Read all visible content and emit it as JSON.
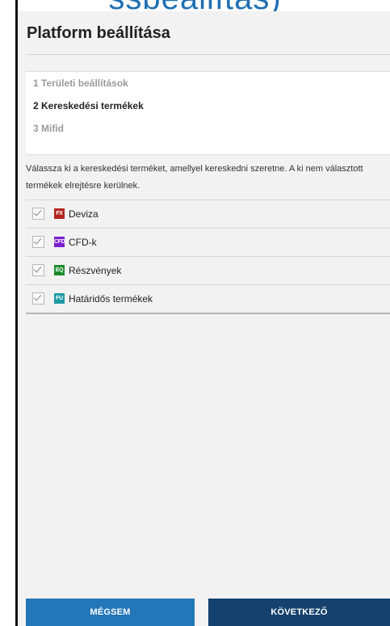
{
  "window": {
    "top_caption": "ssbeállítás)"
  },
  "header": {
    "title": "Platform beállítása"
  },
  "steps": [
    {
      "label": "1 Területi beállítások",
      "state": "inactive"
    },
    {
      "label": "2 Kereskedési termékek",
      "state": "active"
    },
    {
      "label": "3 Mifid",
      "state": "inactive"
    }
  ],
  "description": "Válassza ki a kereskedési terméket, amellyel kereskedni szeretne. A ki nem választott termékek elrejtésre kerülnek.",
  "products": [
    {
      "badge": "FX",
      "label": "Deviza",
      "checked": true,
      "badge_color": "#b3261e"
    },
    {
      "badge": "CFD",
      "label": "CFD-k",
      "checked": true,
      "badge_color": "#7b1fd1"
    },
    {
      "badge": "EQ",
      "label": "Részvények",
      "checked": true,
      "badge_color": "#1e8a2e"
    },
    {
      "badge": "FU",
      "label": "Határidős termékek",
      "checked": true,
      "badge_color": "#1e9aa6"
    }
  ],
  "footer": {
    "cancel_label": "MÉGSEM",
    "next_label": "KÖVETKEZŐ"
  },
  "colors": {
    "cancel_button": "#2376b7",
    "next_button": "#14416d",
    "dialog_background": "#f2f2f2"
  }
}
